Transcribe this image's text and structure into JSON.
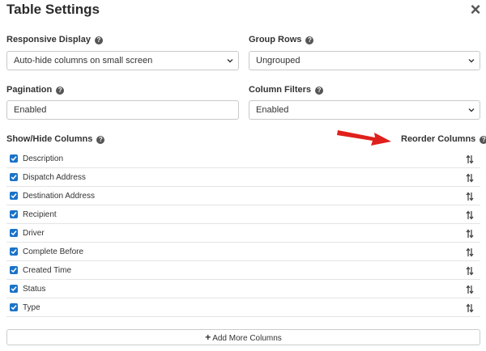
{
  "dialog": {
    "title": "Table Settings",
    "close_glyph": "×"
  },
  "fields": {
    "responsive_display": {
      "label": "Responsive Display",
      "value": "Auto-hide columns on small screen"
    },
    "group_rows": {
      "label": "Group Rows",
      "value": "Ungrouped"
    },
    "pagination": {
      "label": "Pagination",
      "value": "Enabled"
    },
    "column_filters": {
      "label": "Column Filters",
      "value": "Enabled"
    }
  },
  "columns": {
    "show_hide_label": "Show/Hide Columns",
    "reorder_label": "Reorder Columns",
    "items": [
      {
        "label": "Description",
        "checked": true
      },
      {
        "label": "Dispatch Address",
        "checked": true
      },
      {
        "label": "Destination Address",
        "checked": true
      },
      {
        "label": "Recipient",
        "checked": true
      },
      {
        "label": "Driver",
        "checked": true
      },
      {
        "label": "Complete Before",
        "checked": true
      },
      {
        "label": "Created Time",
        "checked": true
      },
      {
        "label": "Status",
        "checked": true
      },
      {
        "label": "Type",
        "checked": true
      }
    ]
  },
  "add_more_columns": {
    "label": "Add More Columns"
  },
  "colors": {
    "checkbox": "#1a73c8",
    "annotation_arrow": "#e0201b",
    "border": "#c9c9c9"
  },
  "icons": {
    "close": "close-icon",
    "help": "help-circle-icon",
    "chevron": "chevron-down-icon",
    "drag": "sort-arrows-icon",
    "plus": "plus-icon",
    "annotation": "red-arrow-icon"
  }
}
